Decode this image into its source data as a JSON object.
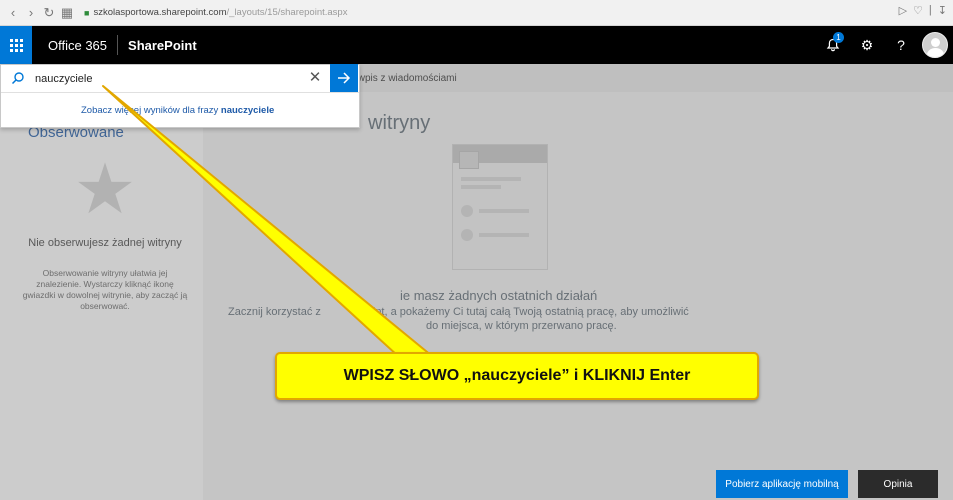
{
  "browser": {
    "url_host": "szkolasportowa.sharepoint.com",
    "url_path": "/_layouts/15/sharepoint.aspx",
    "url_prefix": ""
  },
  "suitebar": {
    "brand": "Office 365",
    "app_name": "SharePoint",
    "notification_count": "1",
    "accent_color": "#0078d7"
  },
  "search": {
    "query": "nauczyciele",
    "more_results_prefix": "Zobacz więcej wyników dla frazy",
    "more_results_term": "nauczyciele"
  },
  "page": {
    "post_hint": "z wpis z wiadomościami",
    "followed_title": "Obserwowane",
    "no_follow_title": "Nie obserwujesz żadnej witryny",
    "no_follow_desc": "Obserwowanie witryny ułatwia jej znalezienie. Wystarczy kliknąć ikonę gwiazdki w dowolnej witrynie, aby zacząć ją obserwować.",
    "recent_title": "witryny",
    "no_activity_title": "ie masz żadnych ostatnich działań",
    "no_activity_line1": "Zacznij korzystać z               oint, a pokażemy Ci tutaj całą Twoją ostatnią pracę, aby umożliwić",
    "no_activity_line2": "do miejsca, w którym przerwano pracę."
  },
  "callout": {
    "text": "WPISZ SŁOWO  „nauczyciele” i KLIKNIJ Enter",
    "color": "#ffff00"
  },
  "footer": {
    "mobile_app_button": "Pobierz aplikację mobilną",
    "feedback_button": "Opinia"
  }
}
